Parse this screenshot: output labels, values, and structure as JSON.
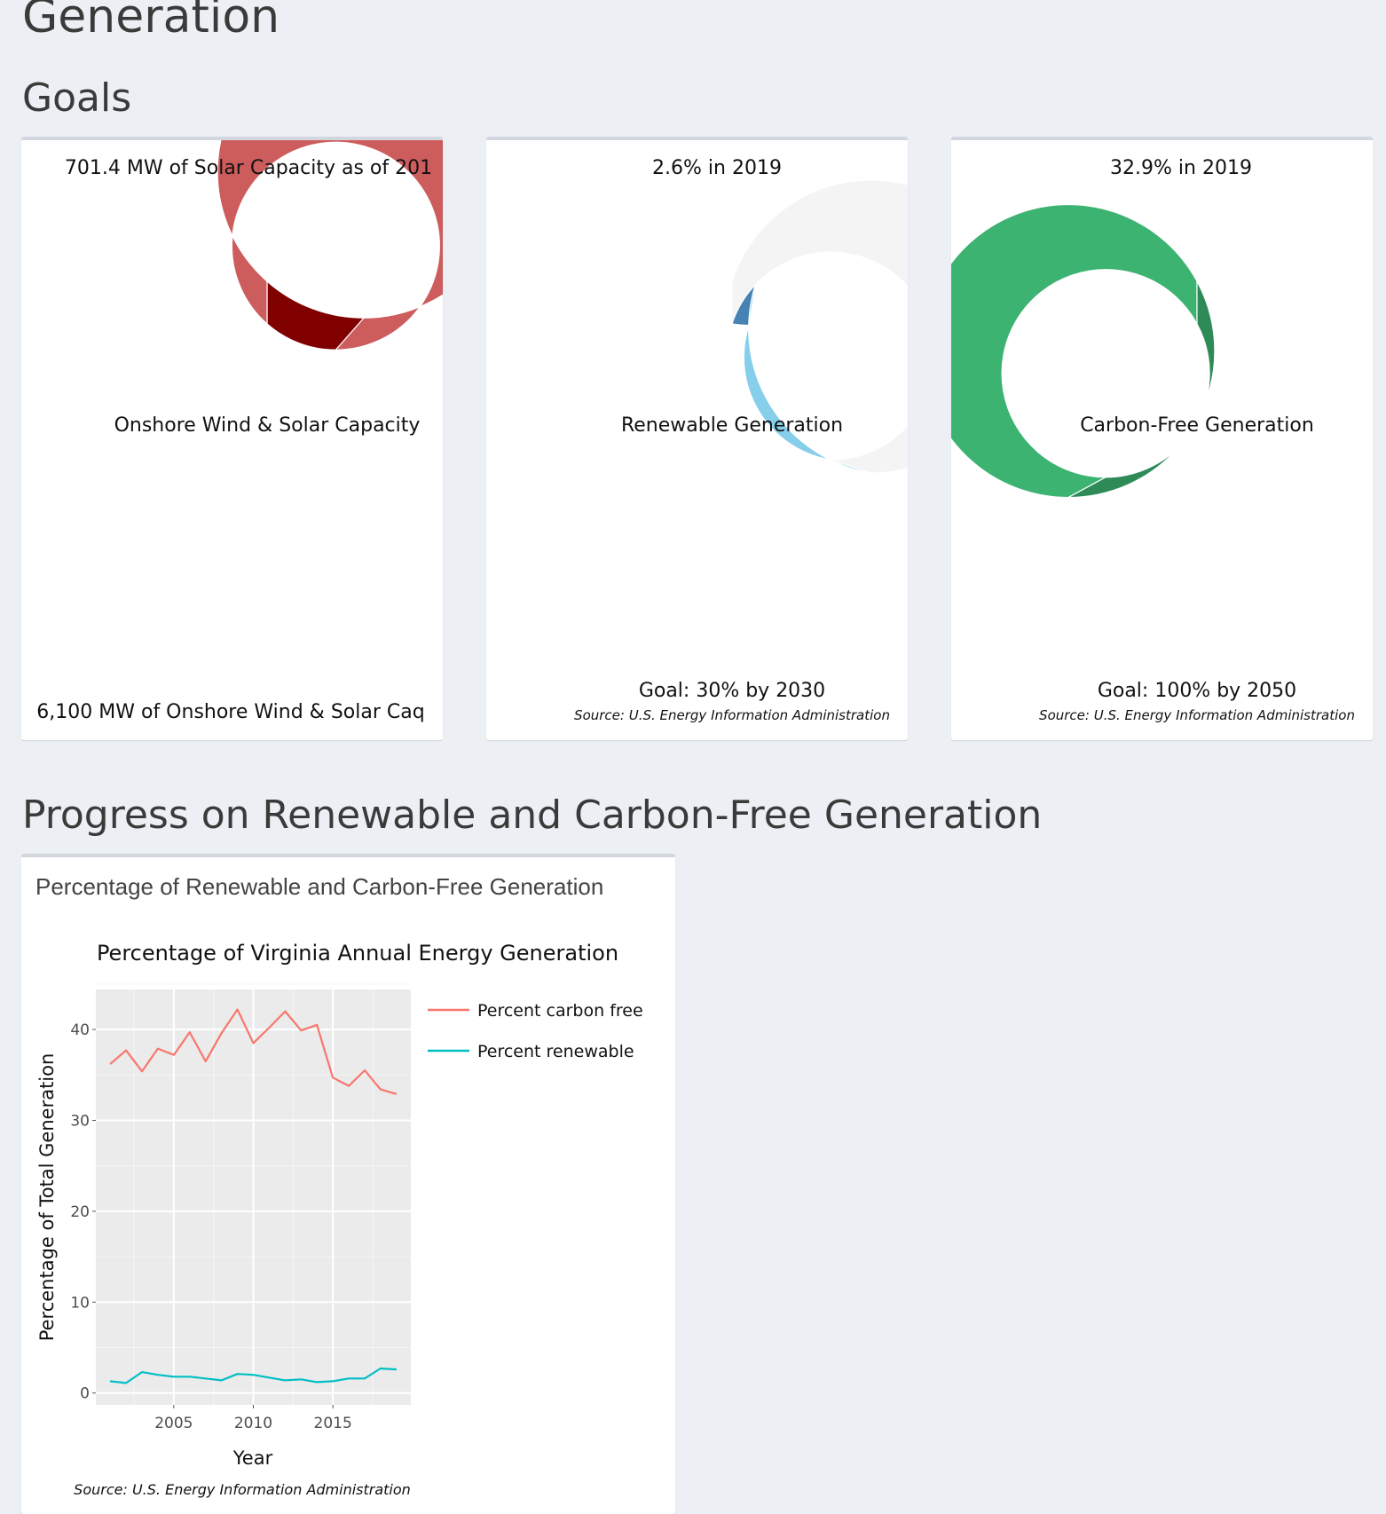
{
  "page": {
    "title": "Generation",
    "goals_heading": "Goals",
    "progress_heading": "Progress on Renewable and Carbon-Free Generation"
  },
  "goals": [
    {
      "top_text": "701.4 MW of Solar Capacity as of 201",
      "center_label": "Onshore Wind & Solar Capacity",
      "bottom_text": "6,100 MW of Onshore Wind & Solar Caq",
      "source": "",
      "chart_data": {
        "type": "pie",
        "hole": true,
        "values": [
          701.4,
          5398.6
        ],
        "colors": [
          "#800000",
          "#cd5c5c"
        ]
      }
    },
    {
      "top_text": "2.6% in 2019",
      "center_label": "Renewable Generation",
      "bottom_text": "Goal: 30% by 2030",
      "source": "Source: U.S. Energy Information Administration",
      "chart_data": {
        "type": "pie",
        "hole": true,
        "values": [
          2.6,
          27.4,
          70
        ],
        "colors": [
          "#4682b4",
          "#87ceeb",
          "#f4f4f4"
        ]
      }
    },
    {
      "top_text": "32.9% in 2019",
      "center_label": "Carbon-Free Generation",
      "bottom_text": "Goal: 100% by 2050",
      "source": "Source: U.S. Energy Information Administration",
      "chart_data": {
        "type": "pie",
        "hole": true,
        "values": [
          67.1,
          32.9
        ],
        "colors": [
          "#3cb371",
          "#2e8b57"
        ]
      }
    }
  ],
  "progress_box": {
    "title": "Percentage of Renewable and Carbon-Free Generation",
    "source": "Source: U.S. Energy Information Administration"
  },
  "chart_data": {
    "type": "line",
    "title": "Percentage of Virginia Annual Energy Generation",
    "xlabel": "Year",
    "ylabel": "Percentage of Total Generation",
    "x": [
      2001,
      2002,
      2003,
      2004,
      2005,
      2006,
      2007,
      2008,
      2009,
      2010,
      2011,
      2012,
      2013,
      2014,
      2015,
      2016,
      2017,
      2018,
      2019
    ],
    "xticks": [
      2005,
      2010,
      2015
    ],
    "yticks": [
      0,
      10,
      20,
      30,
      40
    ],
    "xlim": [
      2000.1,
      2019.9
    ],
    "ylim": [
      -1.3,
      44.4
    ],
    "grid": true,
    "legend_position": "right",
    "series": [
      {
        "name": "Percent carbon free",
        "color": "#f8766d",
        "values": [
          36.2,
          37.7,
          35.4,
          37.9,
          37.2,
          39.7,
          36.5,
          39.6,
          42.2,
          38.5,
          40.2,
          42.0,
          39.9,
          40.5,
          34.7,
          33.8,
          35.5,
          33.4,
          32.9
        ]
      },
      {
        "name": "Percent renewable",
        "color": "#00bfc4",
        "values": [
          1.3,
          1.1,
          2.3,
          2.0,
          1.8,
          1.8,
          1.6,
          1.4,
          2.1,
          2.0,
          1.7,
          1.4,
          1.5,
          1.2,
          1.3,
          1.6,
          1.6,
          2.7,
          2.6
        ]
      }
    ]
  }
}
